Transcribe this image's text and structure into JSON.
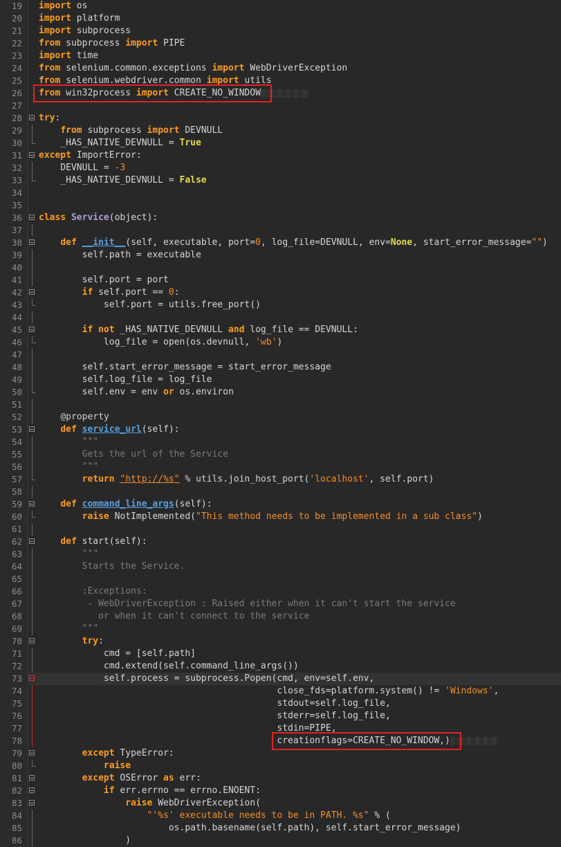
{
  "lines": [
    {
      "n": "19",
      "code": [
        [
          "kw",
          "import"
        ],
        [
          "t",
          " os"
        ]
      ]
    },
    {
      "n": "20",
      "code": [
        [
          "kw",
          "import"
        ],
        [
          "t",
          " platform"
        ]
      ]
    },
    {
      "n": "21",
      "code": [
        [
          "kw",
          "import"
        ],
        [
          "t",
          " subprocess"
        ]
      ]
    },
    {
      "n": "22",
      "code": [
        [
          "kw",
          "from"
        ],
        [
          "t",
          " subprocess "
        ],
        [
          "kw",
          "import"
        ],
        [
          "t",
          " PIPE"
        ]
      ]
    },
    {
      "n": "23",
      "code": [
        [
          "kw",
          "import"
        ],
        [
          "t",
          " time"
        ]
      ]
    },
    {
      "n": "24",
      "code": [
        [
          "kw",
          "from"
        ],
        [
          "t",
          " selenium.common.exceptions "
        ],
        [
          "kw",
          "import"
        ],
        [
          "t",
          " WebDriverException"
        ]
      ]
    },
    {
      "n": "25",
      "code": [
        [
          "kw",
          "from"
        ],
        [
          "t",
          " selenium.webdriver.common "
        ],
        [
          "kw",
          "import"
        ],
        [
          "t",
          " utils"
        ]
      ]
    },
    {
      "n": "26",
      "code": [
        [
          "kw",
          "from"
        ],
        [
          "t",
          " win32process "
        ],
        [
          "kw",
          "import"
        ],
        [
          "t",
          " CREATE_NO_WINDOW"
        ]
      ],
      "blur": true
    },
    {
      "n": "27",
      "code": []
    },
    {
      "n": "28",
      "fold": "start",
      "code": [
        [
          "kw",
          "try"
        ],
        [
          "t",
          ":"
        ]
      ]
    },
    {
      "n": "29",
      "fold": "line",
      "code": [
        [
          "t",
          "    "
        ],
        [
          "kw",
          "from"
        ],
        [
          "t",
          " subprocess "
        ],
        [
          "kw",
          "import"
        ],
        [
          "t",
          " DEVNULL"
        ]
      ]
    },
    {
      "n": "30",
      "fold": "end",
      "code": [
        [
          "t",
          "    _HAS_NATIVE_DEVNULL = "
        ],
        [
          "bi",
          "True"
        ]
      ]
    },
    {
      "n": "31",
      "fold": "start",
      "code": [
        [
          "kw",
          "except"
        ],
        [
          "t",
          " ImportError:"
        ]
      ]
    },
    {
      "n": "32",
      "fold": "line",
      "code": [
        [
          "t",
          "    DEVNULL = "
        ],
        [
          "num",
          "-3"
        ]
      ]
    },
    {
      "n": "33",
      "fold": "end",
      "code": [
        [
          "t",
          "    _HAS_NATIVE_DEVNULL = "
        ],
        [
          "bi",
          "False"
        ]
      ]
    },
    {
      "n": "34",
      "code": []
    },
    {
      "n": "35",
      "code": []
    },
    {
      "n": "36",
      "fold": "start",
      "code": [
        [
          "kw",
          "class"
        ],
        [
          "t",
          " "
        ],
        [
          "cls",
          "Service"
        ],
        [
          "t",
          "(object):"
        ]
      ]
    },
    {
      "n": "37",
      "fold": "line",
      "code": []
    },
    {
      "n": "38",
      "fold": "start",
      "code": [
        [
          "t",
          "    "
        ],
        [
          "kw",
          "def"
        ],
        [
          "t",
          " "
        ],
        [
          "fn",
          "__init__"
        ],
        [
          "t",
          "(self, executable, port="
        ],
        [
          "num",
          "0"
        ],
        [
          "t",
          ", log_file=DEVNULL, env="
        ],
        [
          "bi",
          "None"
        ],
        [
          "t",
          ", start_error_message="
        ],
        [
          "str",
          "\"\""
        ],
        [
          "t",
          ")"
        ]
      ]
    },
    {
      "n": "39",
      "fold": "line",
      "code": [
        [
          "t",
          "        self.path = executable"
        ]
      ]
    },
    {
      "n": "40",
      "fold": "line",
      "code": []
    },
    {
      "n": "41",
      "fold": "line",
      "code": [
        [
          "t",
          "        self.port = port"
        ]
      ]
    },
    {
      "n": "42",
      "fold": "start",
      "code": [
        [
          "t",
          "        "
        ],
        [
          "kw",
          "if"
        ],
        [
          "t",
          " self.port == "
        ],
        [
          "num",
          "0"
        ],
        [
          "t",
          ":"
        ]
      ]
    },
    {
      "n": "43",
      "fold": "end",
      "code": [
        [
          "t",
          "            self.port = utils.free_port()"
        ]
      ]
    },
    {
      "n": "44",
      "fold": "line",
      "code": []
    },
    {
      "n": "45",
      "fold": "start",
      "code": [
        [
          "t",
          "        "
        ],
        [
          "kw",
          "if"
        ],
        [
          "t",
          " "
        ],
        [
          "kw",
          "not"
        ],
        [
          "t",
          " _HAS_NATIVE_DEVNULL "
        ],
        [
          "kw",
          "and"
        ],
        [
          "t",
          " log_file == DEVNULL:"
        ]
      ]
    },
    {
      "n": "46",
      "fold": "end",
      "code": [
        [
          "t",
          "            log_file = open(os.devnull, "
        ],
        [
          "str",
          "'wb'"
        ],
        [
          "t",
          ")"
        ]
      ]
    },
    {
      "n": "47",
      "fold": "line",
      "code": []
    },
    {
      "n": "48",
      "fold": "line",
      "code": [
        [
          "t",
          "        self.start_error_message = start_error_message"
        ]
      ]
    },
    {
      "n": "49",
      "fold": "line",
      "code": [
        [
          "t",
          "        self.log_file = log_file"
        ]
      ]
    },
    {
      "n": "50",
      "fold": "end",
      "code": [
        [
          "t",
          "        self.env = env "
        ],
        [
          "kw",
          "or"
        ],
        [
          "t",
          " os.environ"
        ]
      ]
    },
    {
      "n": "51",
      "fold": "line",
      "code": []
    },
    {
      "n": "52",
      "fold": "line",
      "code": [
        [
          "t",
          "    "
        ],
        [
          "dec",
          "@property"
        ]
      ]
    },
    {
      "n": "53",
      "fold": "start",
      "code": [
        [
          "t",
          "    "
        ],
        [
          "kw",
          "def"
        ],
        [
          "t",
          " "
        ],
        [
          "fn",
          "service_url"
        ],
        [
          "t",
          "(self):"
        ]
      ]
    },
    {
      "n": "54",
      "fold": "line",
      "code": [
        [
          "t",
          "        "
        ],
        [
          "com",
          "\"\"\""
        ]
      ]
    },
    {
      "n": "55",
      "fold": "line",
      "code": [
        [
          "t",
          "        "
        ],
        [
          "com",
          "Gets the url of the Service"
        ]
      ]
    },
    {
      "n": "56",
      "fold": "line",
      "code": [
        [
          "t",
          "        "
        ],
        [
          "com",
          "\"\"\""
        ]
      ]
    },
    {
      "n": "57",
      "fold": "end",
      "code": [
        [
          "t",
          "        "
        ],
        [
          "kw",
          "return"
        ],
        [
          "t",
          " "
        ],
        [
          "url",
          "\"http://%s\""
        ],
        [
          "t",
          " % utils.join_host_port("
        ],
        [
          "str",
          "'localhost'"
        ],
        [
          "t",
          ", self.port)"
        ]
      ]
    },
    {
      "n": "58",
      "fold": "line",
      "code": []
    },
    {
      "n": "59",
      "fold": "start",
      "code": [
        [
          "t",
          "    "
        ],
        [
          "kw",
          "def"
        ],
        [
          "t",
          " "
        ],
        [
          "fn",
          "command_line_args"
        ],
        [
          "t",
          "(self):"
        ]
      ]
    },
    {
      "n": "60",
      "fold": "end",
      "code": [
        [
          "t",
          "        "
        ],
        [
          "kw",
          "raise"
        ],
        [
          "t",
          " NotImplemented("
        ],
        [
          "str",
          "\"This method needs to be implemented in a sub class\""
        ],
        [
          "t",
          ")"
        ]
      ]
    },
    {
      "n": "61",
      "fold": "line",
      "code": []
    },
    {
      "n": "62",
      "fold": "start",
      "code": [
        [
          "t",
          "    "
        ],
        [
          "kw",
          "def"
        ],
        [
          "t",
          " start(self):"
        ]
      ]
    },
    {
      "n": "63",
      "fold": "line",
      "code": [
        [
          "t",
          "        "
        ],
        [
          "com",
          "\"\"\""
        ]
      ]
    },
    {
      "n": "64",
      "fold": "line",
      "code": [
        [
          "t",
          "        "
        ],
        [
          "com",
          "Starts the Service."
        ]
      ]
    },
    {
      "n": "65",
      "fold": "line",
      "code": []
    },
    {
      "n": "66",
      "fold": "line",
      "code": [
        [
          "t",
          "        "
        ],
        [
          "com",
          ":Exceptions:"
        ]
      ]
    },
    {
      "n": "67",
      "fold": "line",
      "code": [
        [
          "t",
          "        "
        ],
        [
          "com",
          " - WebDriverException : Raised either when it can't start the service"
        ]
      ]
    },
    {
      "n": "68",
      "fold": "line",
      "code": [
        [
          "t",
          "        "
        ],
        [
          "com",
          "   or when it can't connect to the service"
        ]
      ]
    },
    {
      "n": "69",
      "fold": "line",
      "code": [
        [
          "t",
          "        "
        ],
        [
          "com",
          "\"\"\""
        ]
      ]
    },
    {
      "n": "70",
      "fold": "start",
      "code": [
        [
          "t",
          "        "
        ],
        [
          "kw",
          "try"
        ],
        [
          "t",
          ":"
        ]
      ]
    },
    {
      "n": "71",
      "fold": "line",
      "code": [
        [
          "t",
          "            cmd = [self.path]"
        ]
      ]
    },
    {
      "n": "72",
      "fold": "line",
      "code": [
        [
          "t",
          "            cmd.extend(self.command_line_args())"
        ]
      ]
    },
    {
      "n": "73",
      "fold": "redstart",
      "current": true,
      "code": [
        [
          "t",
          "            self.process = subprocess.Popen(cmd, env=self.env,"
        ]
      ]
    },
    {
      "n": "74",
      "fold": "red",
      "code": [
        [
          "t",
          "                                            close_fds=platform.system() != "
        ],
        [
          "str",
          "'Windows'"
        ],
        [
          "t",
          ","
        ]
      ]
    },
    {
      "n": "75",
      "fold": "red",
      "code": [
        [
          "t",
          "                                            stdout=self.log_file,"
        ]
      ]
    },
    {
      "n": "76",
      "fold": "red",
      "code": [
        [
          "t",
          "                                            stderr=self.log_file,"
        ]
      ]
    },
    {
      "n": "77",
      "fold": "red",
      "code": [
        [
          "t",
          "                                            stdin=PIPE,"
        ]
      ]
    },
    {
      "n": "78",
      "fold": "red",
      "code": [
        [
          "t",
          "                                            creationflags=CREATE_NO_WINDOW,)"
        ]
      ],
      "blur": true
    },
    {
      "n": "79",
      "fold": "start",
      "code": [
        [
          "t",
          "        "
        ],
        [
          "kw",
          "except"
        ],
        [
          "t",
          " TypeError:"
        ]
      ]
    },
    {
      "n": "80",
      "fold": "end",
      "code": [
        [
          "t",
          "            "
        ],
        [
          "kw",
          "raise"
        ]
      ]
    },
    {
      "n": "81",
      "fold": "start",
      "code": [
        [
          "t",
          "        "
        ],
        [
          "kw",
          "except"
        ],
        [
          "t",
          " OSError "
        ],
        [
          "kw",
          "as"
        ],
        [
          "t",
          " err:"
        ]
      ]
    },
    {
      "n": "82",
      "fold": "start",
      "code": [
        [
          "t",
          "            "
        ],
        [
          "kw",
          "if"
        ],
        [
          "t",
          " err.errno == errno.ENOENT:"
        ]
      ]
    },
    {
      "n": "83",
      "fold": "start",
      "code": [
        [
          "t",
          "                "
        ],
        [
          "kw",
          "raise"
        ],
        [
          "t",
          " WebDriverException("
        ]
      ]
    },
    {
      "n": "84",
      "fold": "line",
      "code": [
        [
          "t",
          "                    "
        ],
        [
          "str",
          "\"'%s' executable needs to be in PATH. %s\""
        ],
        [
          "t",
          " % ("
        ]
      ]
    },
    {
      "n": "85",
      "fold": "line",
      "code": [
        [
          "t",
          "                        os.path.basename(self.path), self.start_error_message)"
        ]
      ]
    },
    {
      "n": "86",
      "fold": "line",
      "code": [
        [
          "t",
          "                )"
        ]
      ]
    }
  ],
  "highlight_boxes": [
    {
      "line": "26",
      "label": "win32process import highlight"
    },
    {
      "line": "78",
      "label": "creationflags highlight"
    }
  ]
}
